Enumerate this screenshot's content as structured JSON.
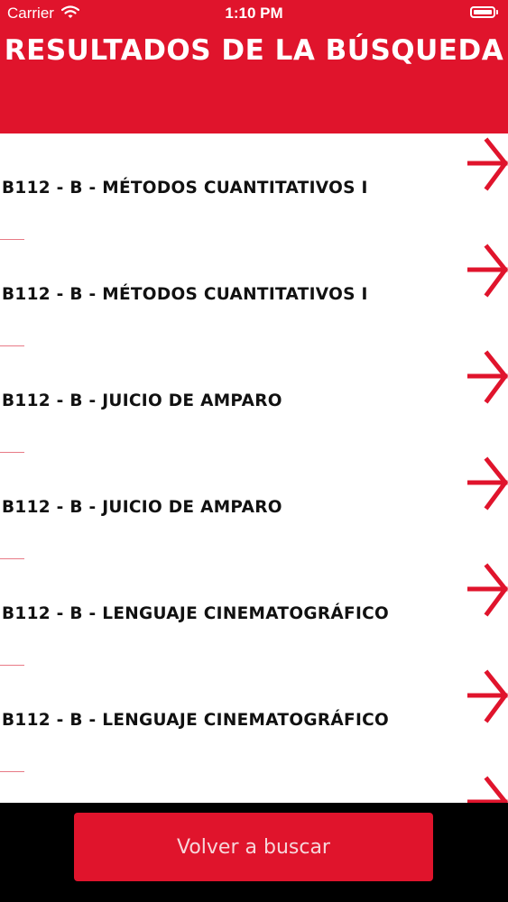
{
  "status_bar": {
    "carrier": "Carrier",
    "time": "1:10 PM"
  },
  "header": {
    "title": "RESULTADOS DE LA BÚSQUEDA"
  },
  "results": [
    {
      "label": "B112 - B - MÉTODOS CUANTITATIVOS I"
    },
    {
      "label": "B112 - B - MÉTODOS CUANTITATIVOS I"
    },
    {
      "label": "B112 - B - JUICIO DE AMPARO"
    },
    {
      "label": "B112 - B - JUICIO DE AMPARO"
    },
    {
      "label": "B112 - B - LENGUAJE CINEMATOGRÁFICO"
    },
    {
      "label": "B112 - B - LENGUAJE CINEMATOGRÁFICO"
    },
    {
      "label": ""
    }
  ],
  "footer": {
    "back_button_label": "Volver a buscar"
  },
  "colors": {
    "brand_red": "#e0142c",
    "footer_bg": "#000000"
  },
  "icons": {
    "row_arrow": "arrow-right-icon"
  }
}
